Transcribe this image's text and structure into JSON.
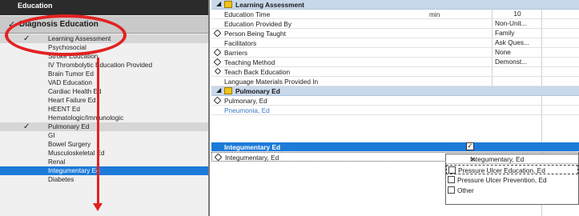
{
  "sidebar": {
    "top_label": "Education",
    "header": "Diagnosis Education",
    "items": [
      {
        "label": "Learning Assessment",
        "checked": true
      },
      {
        "label": "Psychosocial",
        "checked": false
      },
      {
        "label": "Stroke Education",
        "checked": false
      },
      {
        "label": "IV Thrombolytic Education Provided",
        "checked": false
      },
      {
        "label": "Brain Tumor Ed",
        "checked": false
      },
      {
        "label": "VAD Education",
        "checked": false
      },
      {
        "label": "Cardiac Health Ed",
        "checked": false
      },
      {
        "label": "Heart Failure Ed",
        "checked": false
      },
      {
        "label": "HEENT Ed",
        "checked": false
      },
      {
        "label": "Hematologic/Immunologic",
        "checked": false
      },
      {
        "label": "Pulmonary Ed",
        "checked": true
      },
      {
        "label": "GI",
        "checked": false
      },
      {
        "label": "Bowel Surgery",
        "checked": false
      },
      {
        "label": "Musculoskeletal Ed",
        "checked": false
      },
      {
        "label": "Renal",
        "checked": false
      },
      {
        "label": "Integumentary Ed",
        "checked": false,
        "selected": true
      },
      {
        "label": "Diabetes",
        "checked": false
      }
    ]
  },
  "grid": {
    "section_learning": "Learning Assessment",
    "rows_learning": [
      {
        "label": "Education Time",
        "unit": "min",
        "value": "10"
      },
      {
        "label": "Education Provided By",
        "unit": "",
        "value": "Non-Unit..."
      },
      {
        "label": "Person Being Taught",
        "unit": "",
        "value": "Family"
      },
      {
        "label": "Facilitators",
        "unit": "",
        "value": "Ask Ques..."
      },
      {
        "label": "Barriers",
        "unit": "",
        "value": "None"
      },
      {
        "label": "Teaching Method",
        "unit": "",
        "value": "Demonst..."
      },
      {
        "label": "Teach Back Education",
        "unit": "",
        "value": ""
      },
      {
        "label": "Language Materials Provided In",
        "unit": "",
        "value": ""
      }
    ],
    "section_pulmonary": "Pulmonary Ed",
    "rows_pulmonary": [
      {
        "label": "Pulmonary, Ed"
      },
      {
        "label": "Pneumonia, Ed"
      }
    ],
    "row_integ_header": "Integumentary Ed",
    "row_integ": "Integumentary, Ed",
    "dropdown": {
      "title": "Integumentary, Ed",
      "close": "✕",
      "options": [
        "Pressure Ulcer Education, Ed",
        "Pressure Ulcer Prevention, Ed",
        "Other"
      ]
    }
  },
  "colors": {
    "selection": "#1c7ad9",
    "section_band": "#c8d8ea",
    "annotation": "#e32222"
  }
}
